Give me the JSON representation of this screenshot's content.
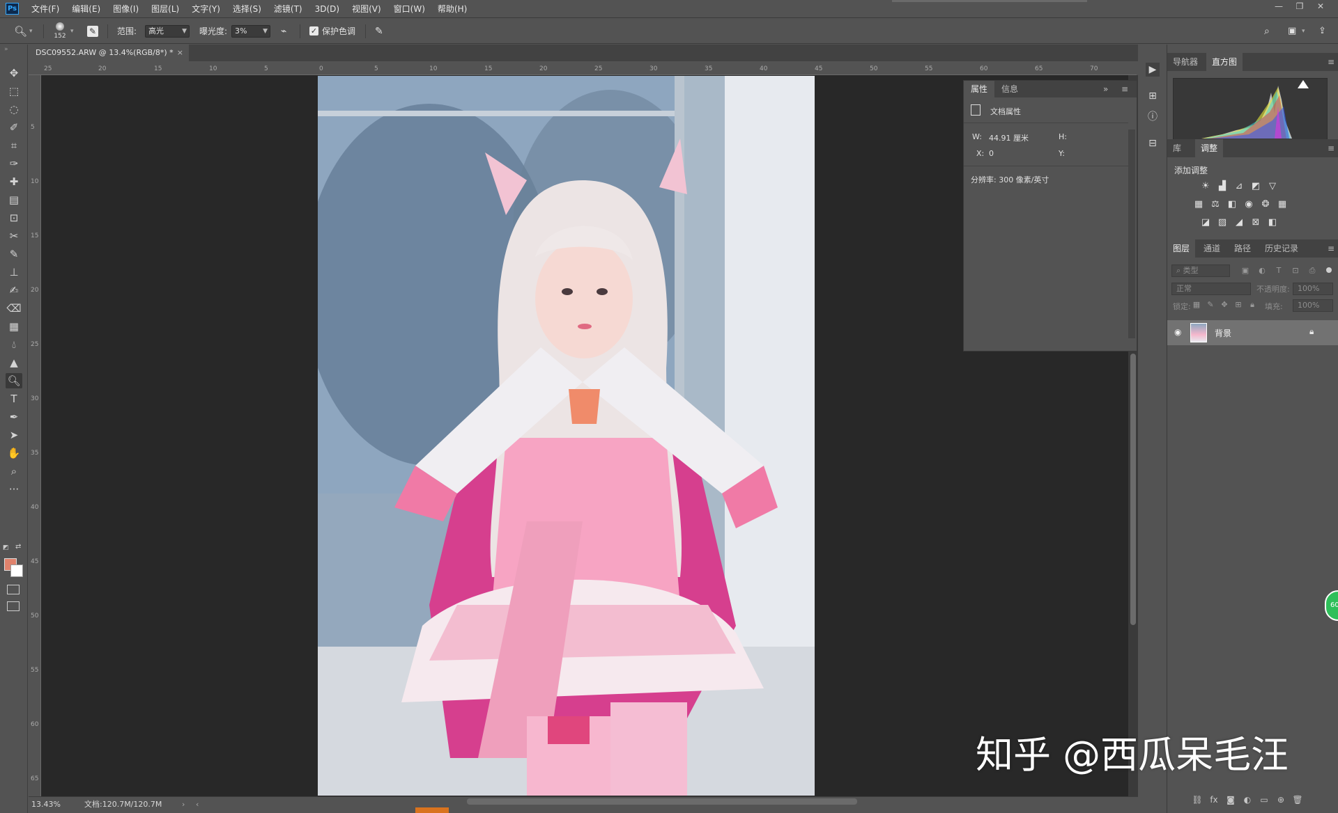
{
  "menubar": {
    "logo": "Ps",
    "items": [
      "文件(F)",
      "编辑(E)",
      "图像(I)",
      "图层(L)",
      "文字(Y)",
      "选择(S)",
      "滤镜(T)",
      "3D(D)",
      "视图(V)",
      "窗口(W)",
      "帮助(H)"
    ],
    "window_controls": [
      "—",
      "❐",
      "✕"
    ]
  },
  "options": {
    "brush_size": "152",
    "range_label": "范围:",
    "range_value": "高光",
    "exposure_label": "曝光度:",
    "exposure_value": "3%",
    "protect_tones_label": "保护色调",
    "protect_tones_checked": true
  },
  "document": {
    "tab_title": "DSC09552.ARW @ 13.4%(RGB/8*)",
    "tab_modified_marker": "*",
    "zoom": "13.43%",
    "doc_size": "文档:120.7M/120.7M",
    "ruler_h_ticks": [
      "25",
      "20",
      "15",
      "10",
      "5",
      "0",
      "5",
      "10",
      "15",
      "20",
      "25",
      "30",
      "35",
      "40",
      "45",
      "50",
      "55",
      "60",
      "65",
      "70"
    ],
    "ruler_v_ticks": [
      "5",
      "10",
      "15",
      "20",
      "25",
      "30",
      "35",
      "40",
      "45",
      "50",
      "55",
      "60",
      "65"
    ]
  },
  "properties": {
    "tabs": [
      "属性",
      "信息"
    ],
    "active_tab": "属性",
    "section": "文档属性",
    "w_label": "W:",
    "w_value": "44.91 厘米",
    "h_label": "H:",
    "x_label": "X:",
    "x_value": "0",
    "y_label": "Y:",
    "resolution": "分辨率: 300 像素/英寸"
  },
  "dock": {
    "top_tabs": [
      "导航器",
      "直方图"
    ],
    "top_active": "直方图",
    "mid_tabs": [
      "库",
      "调整"
    ],
    "mid_active": "调整",
    "add_adjustment": "添加调整",
    "layer_tabs": [
      "图层",
      "通道",
      "路径",
      "历史记录"
    ],
    "layer_active": "图层",
    "kind_filter": "类型",
    "blend_mode": "正常",
    "opacity_label": "不透明度:",
    "opacity_value": "100%",
    "lock_label": "锁定:",
    "fill_label": "填充:",
    "fill_value": "100%",
    "layer_name": "背景"
  },
  "colors": {
    "foreground": "#e0826c",
    "background": "#ffffff",
    "ui_bg": "#535353",
    "canvas_bg": "#282828"
  },
  "overlay": {
    "watermark": "知乎 @西瓜呆毛汪",
    "badge": "60"
  }
}
